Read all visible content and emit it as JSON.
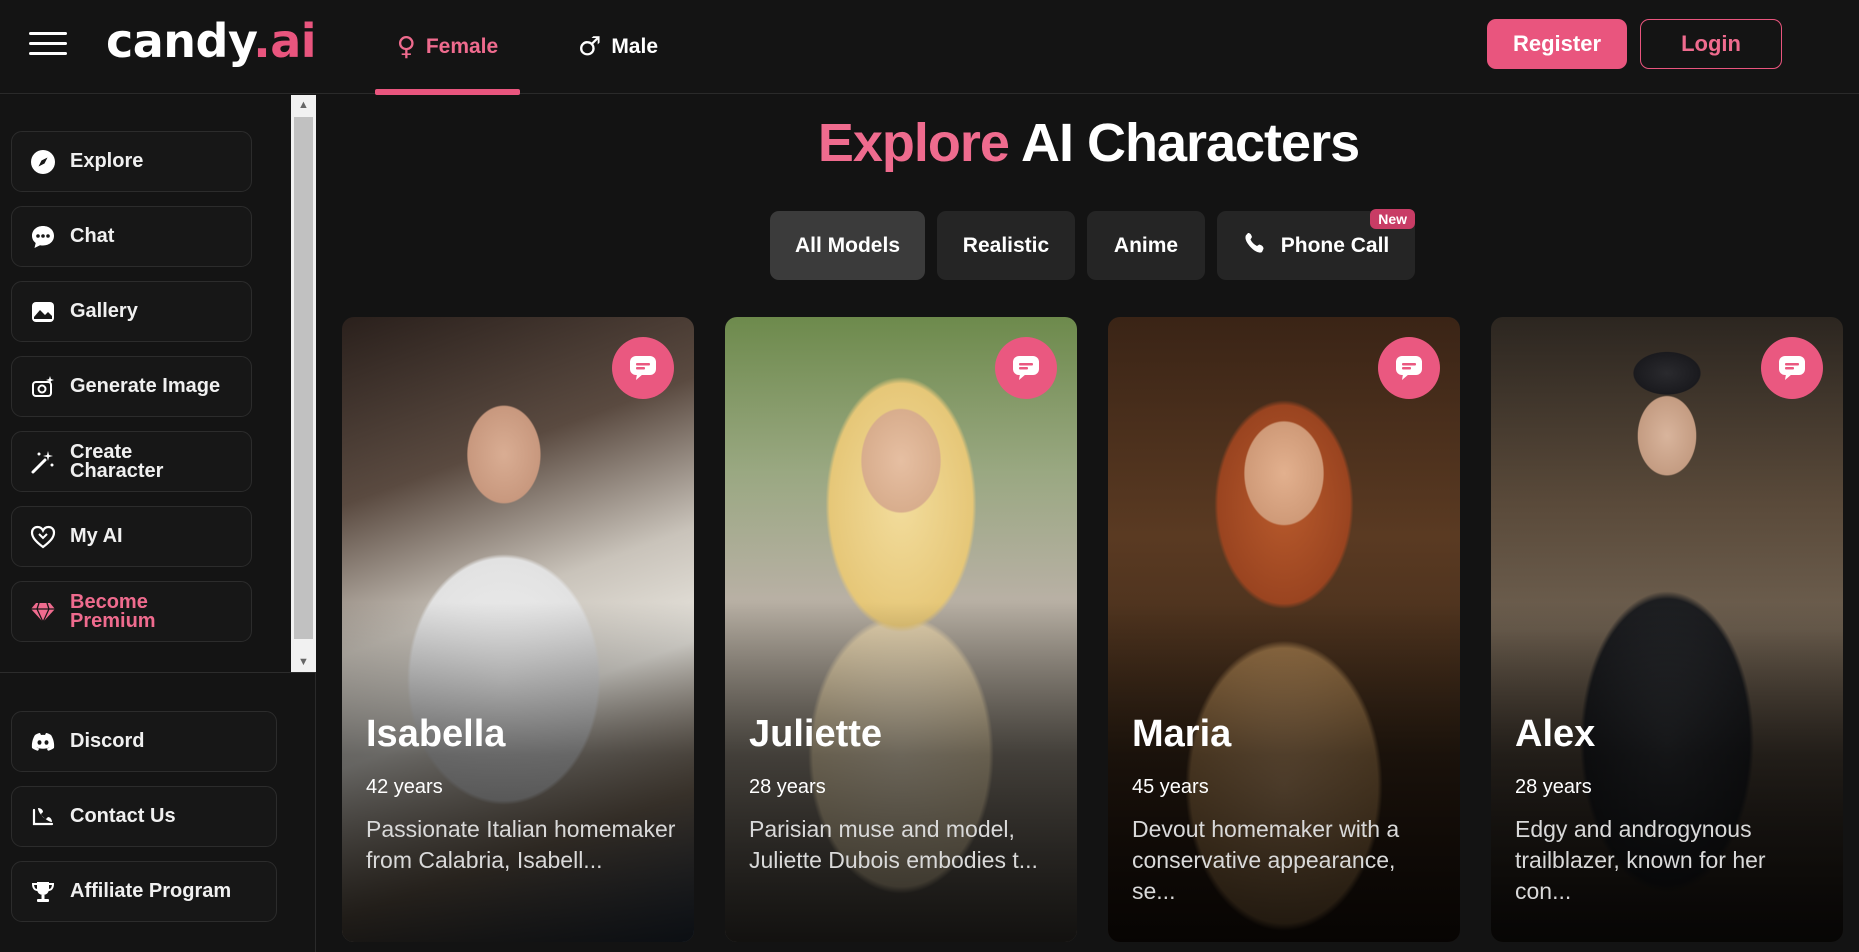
{
  "header": {
    "logo_main": "candy",
    "logo_accent": ".ai",
    "tabs": [
      {
        "label": "Female",
        "symbol": "♀",
        "active": true
      },
      {
        "label": "Male",
        "symbol": "♂",
        "active": false
      }
    ],
    "register_label": "Register",
    "login_label": "Login"
  },
  "sidebar": {
    "items": [
      {
        "label": "Explore",
        "icon": "compass-icon"
      },
      {
        "label": "Chat",
        "icon": "chat-bubble-icon"
      },
      {
        "label": "Gallery",
        "icon": "image-icon"
      },
      {
        "label": "Generate Image",
        "icon": "camera-sparkle-icon"
      },
      {
        "label": "Create Character",
        "icon": "magic-wand-icon"
      },
      {
        "label": "My AI",
        "icon": "heart-icon"
      },
      {
        "label": "Become Premium",
        "icon": "diamond-icon"
      }
    ],
    "bottom_items": [
      {
        "label": "Discord",
        "icon": "discord-icon"
      },
      {
        "label": "Contact Us",
        "icon": "contact-icon"
      },
      {
        "label": "Affiliate Program",
        "icon": "trophy-icon"
      }
    ]
  },
  "main": {
    "title_accent": "Explore",
    "title_rest": " AI Characters",
    "filters": [
      {
        "label": "All Models",
        "active": true
      },
      {
        "label": "Realistic",
        "active": false
      },
      {
        "label": "Anime",
        "active": false
      },
      {
        "label": "Phone Call",
        "active": false,
        "badge": "New",
        "icon": "phone-icon"
      }
    ],
    "characters": [
      {
        "name": "Isabella",
        "age": "42 years",
        "description": "Passionate Italian homemaker from Calabria, Isabell..."
      },
      {
        "name": "Juliette",
        "age": "28 years",
        "description": "Parisian muse and model, Juliette Dubois embodies t..."
      },
      {
        "name": "Maria",
        "age": "45 years",
        "description": "Devout homemaker with a conservative appearance, se..."
      },
      {
        "name": "Alex",
        "age": "28 years",
        "description": "Edgy and androgynous trailblazer, known for her con..."
      }
    ]
  },
  "colors": {
    "accent": "#e9557e",
    "background": "#131313"
  }
}
